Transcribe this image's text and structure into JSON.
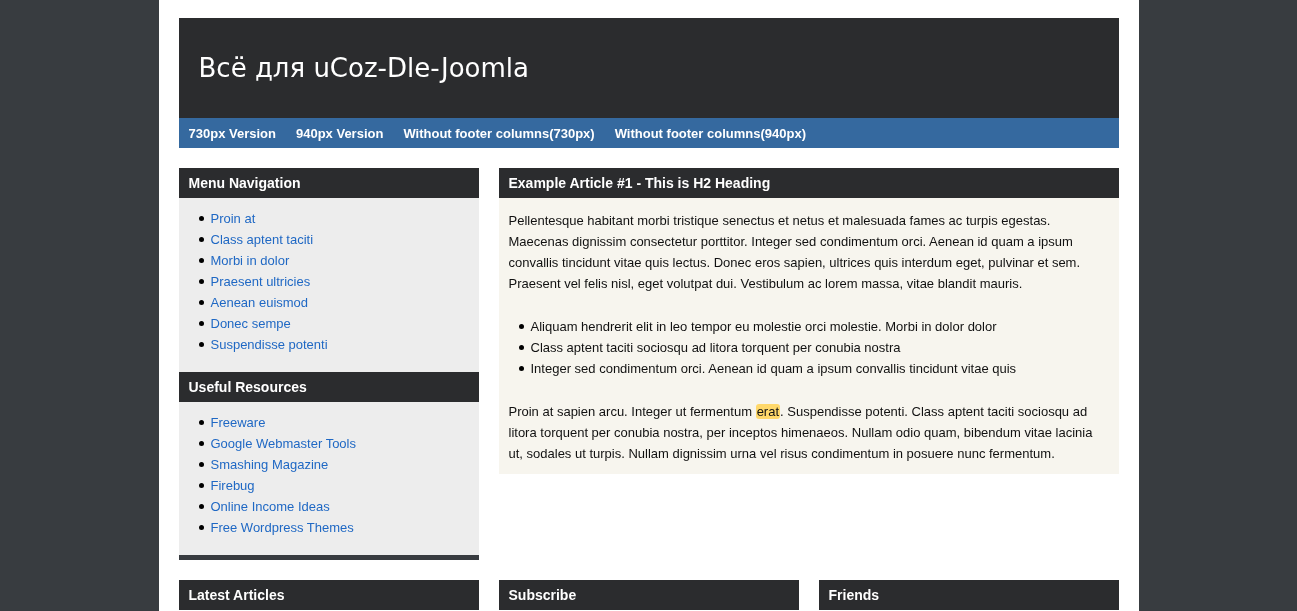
{
  "site_title": "Всё для uCoz-Dle-Joomla",
  "nav": [
    {
      "label": "730px Version"
    },
    {
      "label": "940px Version"
    },
    {
      "label": "Without footer columns(730px)"
    },
    {
      "label": "Without footer columns(940px)"
    }
  ],
  "sidebar": [
    {
      "title": "Menu Navigation",
      "links": [
        "Proin at",
        "Class aptent taciti",
        "Morbi in dolor",
        "Praesent ultricies",
        "Aenean euismod",
        "Donec sempe",
        "Suspendisse potenti"
      ]
    },
    {
      "title": "Useful Resources",
      "links": [
        "Freeware",
        "Google Webmaster Tools",
        "Smashing Magazine",
        "Firebug",
        "Online Income Ideas",
        "Free Wordpress Themes"
      ]
    }
  ],
  "article": {
    "title": "Example Article #1 - This is H2 Heading",
    "paragraph_1": "Pellentesque habitant morbi tristique senectus et netus et malesuada fames ac turpis egestas. Maecenas dignissim consectetur porttitor. Integer sed condimentum orci. Aenean id quam a ipsum convallis tincidunt vitae quis lectus. Donec eros sapien, ultrices quis interdum eget, pulvinar et sem. Praesent vel felis nisl, eget volutpat dui. Vestibulum ac lorem massa, vitae blandit mauris.",
    "list": [
      "Aliquam hendrerit elit in leo tempor eu molestie orci molestie. Morbi in dolor dolor",
      "Class aptent taciti sociosqu ad litora torquent per conubia nostra",
      "Integer sed condimentum orci. Aenean id quam a ipsum convallis tincidunt vitae quis"
    ],
    "paragraph_2": {
      "before": "Proin at sapien arcu. Integer ut fermentum ",
      "highlight": "erat",
      "after": ". Suspendisse potenti. Class aptent taciti sociosqu ad litora torquent per conubia nostra, per inceptos himenaeos. Nullam odio quam, bibendum vitae lacinia ut, sodales ut turpis. Nullam dignissim urna vel risus condimentum in posuere nunc fermentum."
    }
  },
  "footer_columns": [
    {
      "title": "Latest Articles"
    },
    {
      "title": "Subscribe"
    },
    {
      "title": "Friends"
    }
  ]
}
